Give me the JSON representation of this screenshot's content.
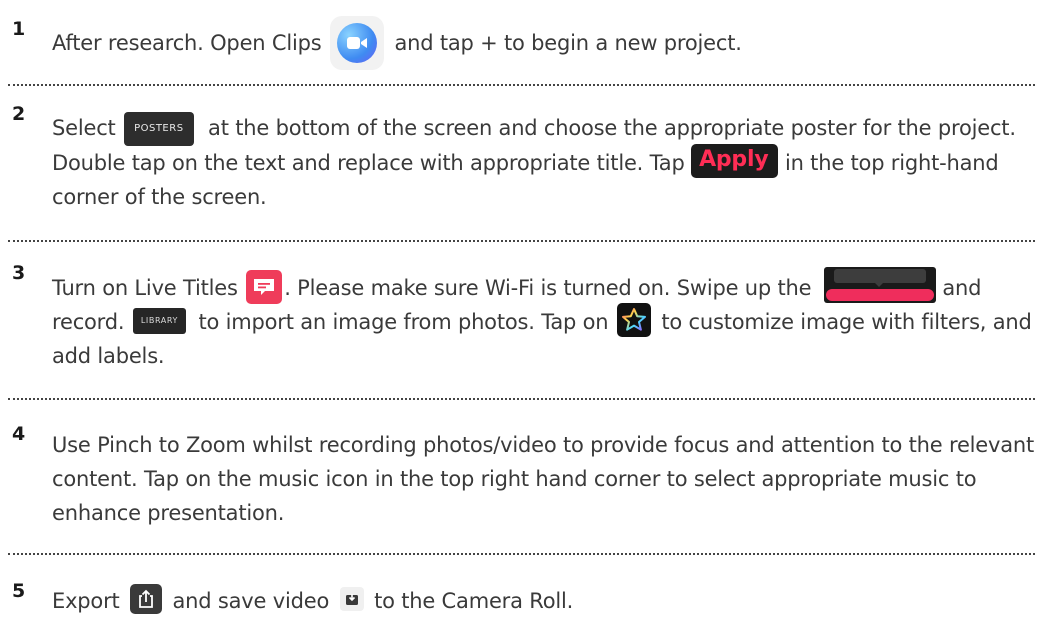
{
  "steps": [
    {
      "number": "1",
      "parts": [
        "After research. Open Clips",
        "and tap + to begin a new project."
      ]
    },
    {
      "number": "2",
      "parts": [
        "Select",
        "at the bottom of the screen and choose the appropriate poster for the project. Double tap on the text and replace with appropriate title. Tap",
        "in the top right-hand corner of the screen."
      ],
      "posters_label": "POSTERS",
      "apply_label": "Apply"
    },
    {
      "number": "3",
      "parts": [
        "Turn on Live Titles",
        ". Please make sure Wi-Fi is turned on. Swipe up the",
        "and record.",
        "to import an image from photos. Tap on",
        "to customize image with filters, and add labels."
      ],
      "library_label": "LIBRARY"
    },
    {
      "number": "4",
      "parts": [
        "Use Pinch to Zoom whilst recording photos/video to provide focus and attention to the relevant content. Tap on the music icon in the top right hand corner to select appropriate music to enhance presentation."
      ]
    },
    {
      "number": "5",
      "parts": [
        "Export",
        "and save video",
        "to the Camera Roll."
      ]
    }
  ],
  "icons": {
    "clips_app": "clips-app-icon",
    "live_titles": "live-titles-icon",
    "record_button": "record-button",
    "effects_star": "star-icon",
    "export": "share-export-icon",
    "save_video": "save-video-icon"
  },
  "colors": {
    "text": "#3a3a3a",
    "accent_red": "#ef2d5c",
    "apply_red": "#ff2d55",
    "clips_blue": "#3f8bf1"
  }
}
